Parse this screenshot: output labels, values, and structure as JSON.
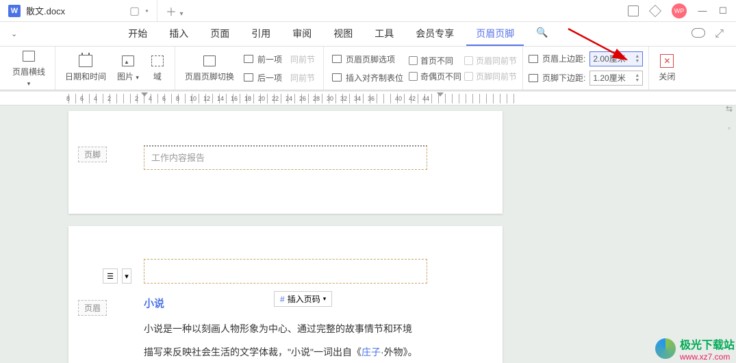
{
  "titlebar": {
    "doc_name": "散文.docx",
    "add": "＋",
    "avatar": "WP"
  },
  "menus": [
    "开始",
    "插入",
    "页面",
    "引用",
    "审阅",
    "视图",
    "工具",
    "会员专享",
    "页眉页脚"
  ],
  "active_menu": 8,
  "ribbon": {
    "header_line": "页眉横线",
    "datetime": "日期和时间",
    "picture": "图片",
    "field": "域",
    "hf_switch": "页眉页脚切换",
    "prev": "前一项",
    "next": "后一项",
    "same_prev": "同前节",
    "hf_options": "页眉页脚选项",
    "insert_tab": "插入对齐制表位",
    "first_diff": "首页不同",
    "odd_even_diff": "奇偶页不同",
    "header_same_prev": "页眉同前节",
    "footer_same_prev": "页脚同前节",
    "header_top": "页眉上边距:",
    "footer_bottom": "页脚下边距:",
    "header_top_val": "2.00厘米",
    "footer_bottom_val": "1.20厘米",
    "close": "关闭"
  },
  "ruler_numbers": [
    "8",
    "6",
    "4",
    "2",
    "",
    "2",
    "4",
    "6",
    "8",
    "10",
    "12",
    "14",
    "16",
    "18",
    "20",
    "22",
    "24",
    "26",
    "28",
    "30",
    "32",
    "34",
    "36",
    "",
    "40",
    "42",
    "44"
  ],
  "doc": {
    "footer_tag": "页脚",
    "header_tag": "页眉",
    "placeholder": "工作内容报告",
    "section_title": "小说",
    "insert_page_num": "插入页码",
    "body1": "小说是一种以刻画人物形象为中心、通过完整的故事情节和环境",
    "body2_a": "描写来反映社会生活的文学体裁，\"小说\"一词出自《",
    "body2_link": "庄子",
    "body2_b": "·外物》。"
  },
  "watermark": {
    "name": "极光下载站",
    "url": "www.xz7.com"
  }
}
